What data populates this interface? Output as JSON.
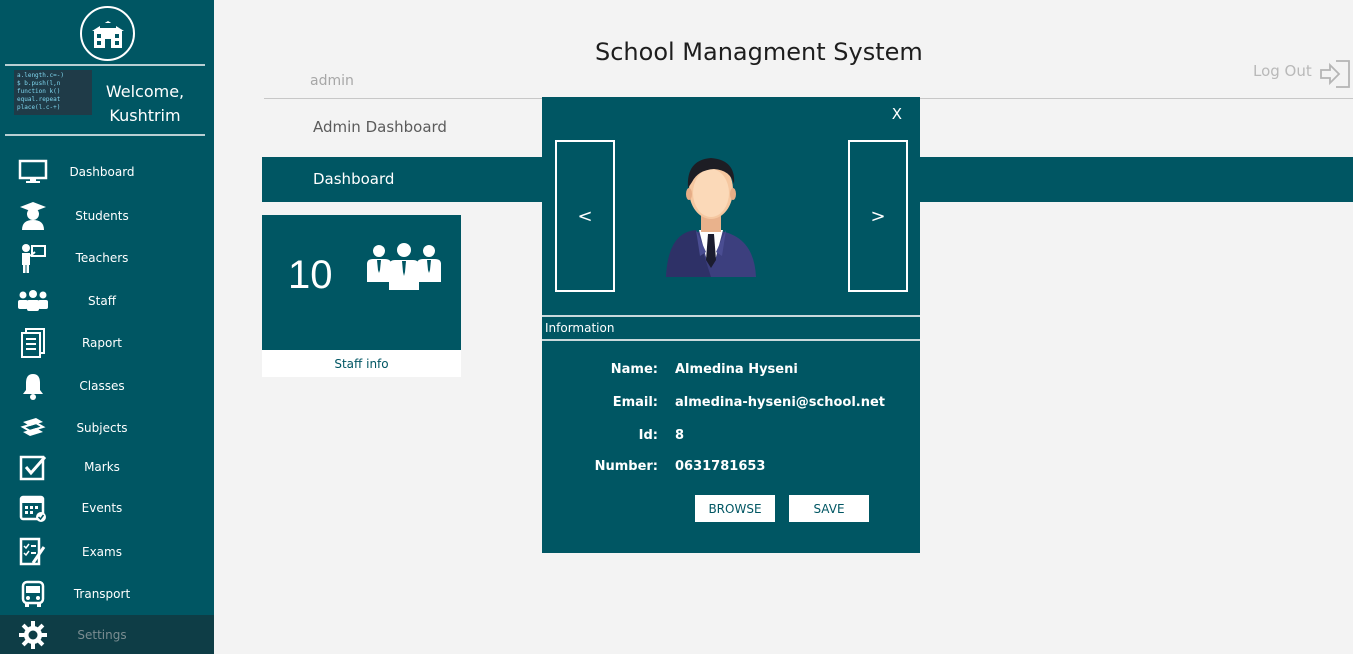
{
  "header": {
    "title": "School Managment System",
    "user": "admin",
    "logout": "Log Out"
  },
  "sidebar": {
    "welcome": "Welcome,",
    "username": "Kushtrim",
    "avatar_code": "a.length.c=-)\n$ b.push(l,n\nfunction k()\nequal.repeat\nplace(l.c-+)",
    "items": [
      {
        "label": "Dashboard",
        "icon": "monitor-icon"
      },
      {
        "label": "Students",
        "icon": "graduate-icon"
      },
      {
        "label": "Teachers",
        "icon": "teacher-icon"
      },
      {
        "label": "Staff",
        "icon": "staff-icon"
      },
      {
        "label": "Raport",
        "icon": "report-icon"
      },
      {
        "label": "Classes",
        "icon": "bell-icon"
      },
      {
        "label": "Subjects",
        "icon": "books-icon"
      },
      {
        "label": "Marks",
        "icon": "checkbox-icon"
      },
      {
        "label": "Events",
        "icon": "calendar-icon"
      },
      {
        "label": "Exams",
        "icon": "exam-icon"
      },
      {
        "label": "Transport",
        "icon": "bus-icon"
      },
      {
        "label": "Settings",
        "icon": "gear-icon"
      }
    ]
  },
  "main": {
    "section_title": "Admin Dashboard",
    "band_title": "Dashboard",
    "tile": {
      "count": "10",
      "footer": "Staff info"
    }
  },
  "modal": {
    "close": "X",
    "prev": "<",
    "next": ">",
    "section": "Information",
    "fields": [
      {
        "label": "Name:",
        "value": "Almedina Hyseni"
      },
      {
        "label": "Email:",
        "value": "almedina-hyseni@school.net"
      },
      {
        "label": "Id:",
        "value": "8"
      },
      {
        "label": "Number:",
        "value": "0631781653"
      }
    ],
    "browse": "BROWSE",
    "save": "SAVE"
  },
  "colors": {
    "primary": "#005663",
    "background": "#f3f3f3",
    "accent_text": "#ffffff"
  }
}
